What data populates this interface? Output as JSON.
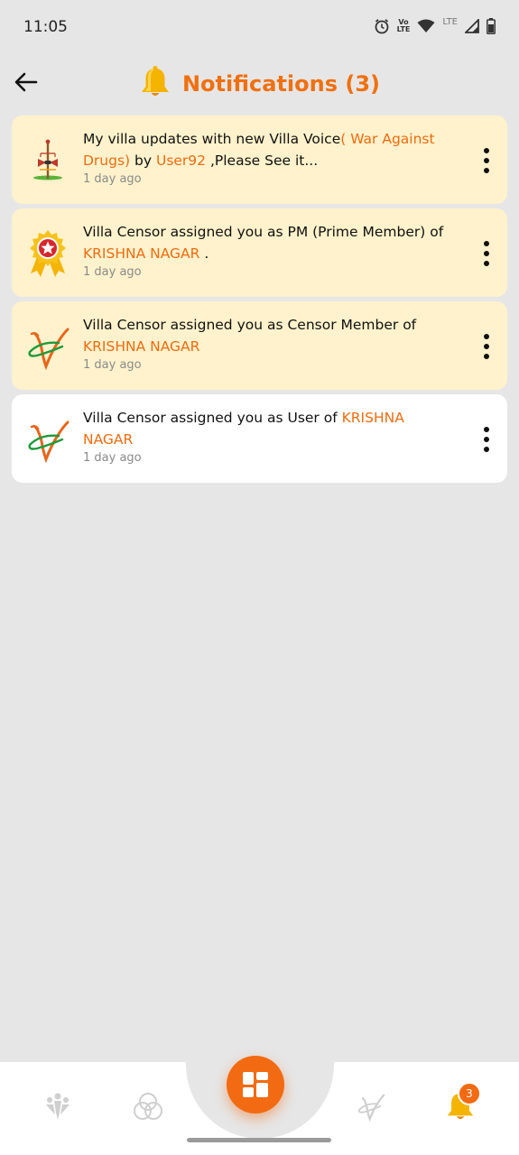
{
  "status_bar": {
    "time": "11:05",
    "volte_top": "Vo",
    "volte_bottom": "LTE",
    "network_label": "LTE"
  },
  "header": {
    "title": "Notifications (3)",
    "back_icon": "arrow-left-icon",
    "bell_icon": "bell-icon"
  },
  "notifications": [
    {
      "icon": "village-voice-icon",
      "unread": true,
      "parts": [
        {
          "text": "My villa updates with new Villa Voice",
          "hl": false
        },
        {
          "text": "( War Against Drugs)",
          "hl": true
        },
        {
          "text": " by ",
          "hl": false
        },
        {
          "text": "User92",
          "hl": true
        },
        {
          "text": " ,Please See it...",
          "hl": false
        }
      ],
      "time": "1 day ago"
    },
    {
      "icon": "award-ribbon-icon",
      "unread": true,
      "parts": [
        {
          "text": "Villa Censor assigned you as PM (Prime Member) of ",
          "hl": false
        },
        {
          "text": "KRISHNA NAGAR",
          "hl": true
        },
        {
          "text": " .",
          "hl": false
        }
      ],
      "time": "1 day ago"
    },
    {
      "icon": "villa-censor-logo-icon",
      "unread": true,
      "parts": [
        {
          "text": "Villa Censor assigned you as Censor Member of ",
          "hl": false
        },
        {
          "text": "KRISHNA NAGAR",
          "hl": true
        }
      ],
      "time": "1 day ago"
    },
    {
      "icon": "villa-censor-logo-icon",
      "unread": false,
      "parts": [
        {
          "text": "Villa Censor assigned you as User of ",
          "hl": false
        },
        {
          "text": "KRISHNA NAGAR",
          "hl": true
        }
      ],
      "time": "1 day ago"
    }
  ],
  "bottom_nav": {
    "items": [
      {
        "name": "nav-people",
        "icon": "people-icon"
      },
      {
        "name": "nav-circles",
        "icon": "circles-icon"
      },
      {
        "name": "nav-dashboard",
        "icon": "dashboard-icon"
      },
      {
        "name": "nav-villa-censor",
        "icon": "villa-censor-logo-icon"
      },
      {
        "name": "nav-notifications",
        "icon": "bell-icon"
      }
    ],
    "badge": "3"
  },
  "colors": {
    "accent": "#f07010",
    "unread_bg": "#fff2cc",
    "read_bg": "#ffffff",
    "page_bg": "#e6e6e6"
  }
}
